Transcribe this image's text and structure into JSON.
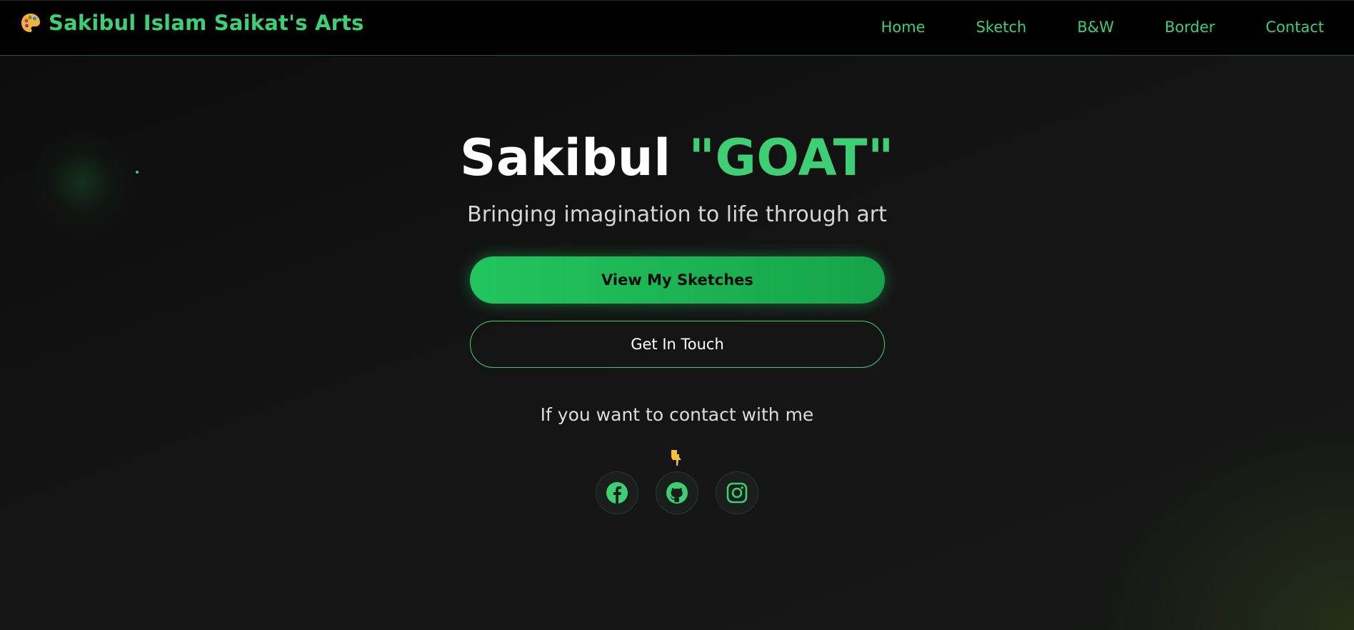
{
  "brand": {
    "name": "Sakibul Islam Saikat's Arts",
    "icon": "palette-icon"
  },
  "nav": {
    "items": [
      {
        "label": "Home"
      },
      {
        "label": "Sketch"
      },
      {
        "label": "B&W"
      },
      {
        "label": "Border"
      },
      {
        "label": "Contact"
      }
    ]
  },
  "hero": {
    "title_first": "Sakibul",
    "title_accent": "\"GOAT\"",
    "tagline": "Bringing imagination to life through art",
    "primary_button": "View My Sketches",
    "secondary_button": "Get In Touch",
    "contact_prompt": "If you want to contact with me",
    "pointer_icon": "pointing-down-hand-icon"
  },
  "socials": [
    {
      "icon": "facebook-icon"
    },
    {
      "icon": "github-icon"
    },
    {
      "icon": "instagram-icon"
    }
  ],
  "colors": {
    "accent": "#3ecf74",
    "button_gradient_start": "#22c55e",
    "button_gradient_end": "#16a34a",
    "navbar_bg": "#000000",
    "page_bg": "#121212"
  }
}
